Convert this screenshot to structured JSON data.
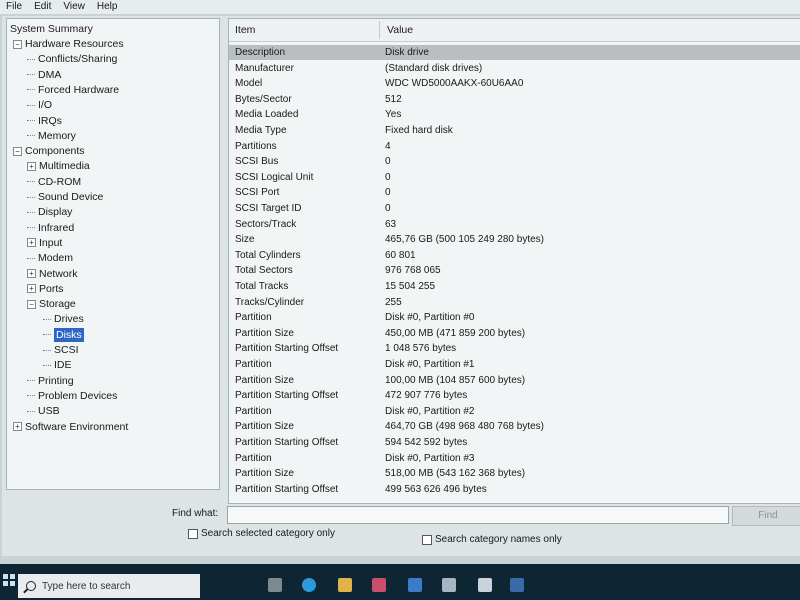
{
  "menu": [
    "File",
    "Edit",
    "View",
    "Help"
  ],
  "tree": {
    "root": "System Summary",
    "items": [
      {
        "label": "Hardware Resources",
        "level": 1,
        "exp": "⊟"
      },
      {
        "label": "Conflicts/Sharing",
        "level": 2
      },
      {
        "label": "DMA",
        "level": 2
      },
      {
        "label": "Forced Hardware",
        "level": 2
      },
      {
        "label": "I/O",
        "level": 2
      },
      {
        "label": "IRQs",
        "level": 2
      },
      {
        "label": "Memory",
        "level": 2
      },
      {
        "label": "Components",
        "level": 1,
        "exp": "⊟"
      },
      {
        "label": "Multimedia",
        "level": 2,
        "exp": "⊞"
      },
      {
        "label": "CD-ROM",
        "level": 2
      },
      {
        "label": "Sound Device",
        "level": 2
      },
      {
        "label": "Display",
        "level": 2
      },
      {
        "label": "Infrared",
        "level": 2
      },
      {
        "label": "Input",
        "level": 2,
        "exp": "⊞"
      },
      {
        "label": "Modem",
        "level": 2
      },
      {
        "label": "Network",
        "level": 2,
        "exp": "⊞"
      },
      {
        "label": "Ports",
        "level": 2,
        "exp": "⊞"
      },
      {
        "label": "Storage",
        "level": 2,
        "exp": "⊟"
      },
      {
        "label": "Drives",
        "level": 3
      },
      {
        "label": "Disks",
        "level": 3,
        "selected": true
      },
      {
        "label": "SCSI",
        "level": 3
      },
      {
        "label": "IDE",
        "level": 3
      },
      {
        "label": "Printing",
        "level": 2
      },
      {
        "label": "Problem Devices",
        "level": 2
      },
      {
        "label": "USB",
        "level": 2
      },
      {
        "label": "Software Environment",
        "level": 1,
        "exp": "⊞"
      }
    ]
  },
  "table": {
    "headers": [
      "Item",
      "Value"
    ],
    "rows": [
      [
        "Description",
        "Disk drive"
      ],
      [
        "Manufacturer",
        "(Standard disk drives)"
      ],
      [
        "Model",
        "WDC WD5000AAKX-60U6AA0"
      ],
      [
        "Bytes/Sector",
        "512"
      ],
      [
        "Media Loaded",
        "Yes"
      ],
      [
        "Media Type",
        "Fixed hard disk"
      ],
      [
        "Partitions",
        "4"
      ],
      [
        "SCSI Bus",
        "0"
      ],
      [
        "SCSI Logical Unit",
        "0"
      ],
      [
        "SCSI Port",
        "0"
      ],
      [
        "SCSI Target ID",
        "0"
      ],
      [
        "Sectors/Track",
        "63"
      ],
      [
        "Size",
        "465,76 GB (500 105 249 280 bytes)"
      ],
      [
        "Total Cylinders",
        "60 801"
      ],
      [
        "Total Sectors",
        "976 768 065"
      ],
      [
        "Total Tracks",
        "15 504 255"
      ],
      [
        "Tracks/Cylinder",
        "255"
      ],
      [
        "Partition",
        "Disk #0, Partition #0"
      ],
      [
        "Partition Size",
        "450,00 MB (471 859 200 bytes)"
      ],
      [
        "Partition Starting Offset",
        "1 048 576 bytes"
      ],
      [
        "Partition",
        "Disk #0, Partition #1"
      ],
      [
        "Partition Size",
        "100,00 MB (104 857 600 bytes)"
      ],
      [
        "Partition Starting Offset",
        "472 907 776 bytes"
      ],
      [
        "Partition",
        "Disk #0, Partition #2"
      ],
      [
        "Partition Size",
        "464,70 GB (498 968 480 768 bytes)"
      ],
      [
        "Partition Starting Offset",
        "594 542 592 bytes"
      ],
      [
        "Partition",
        "Disk #0, Partition #3"
      ],
      [
        "Partition Size",
        "518,00 MB (543 162 368 bytes)"
      ],
      [
        "Partition Starting Offset",
        "499 563 626 496 bytes"
      ]
    ]
  },
  "find": {
    "label": "Find what:",
    "value": "",
    "button": "Find",
    "check1": "Search selected category only",
    "check2": "Search category names only"
  },
  "taskbar": {
    "search_placeholder": "Type here to search"
  }
}
